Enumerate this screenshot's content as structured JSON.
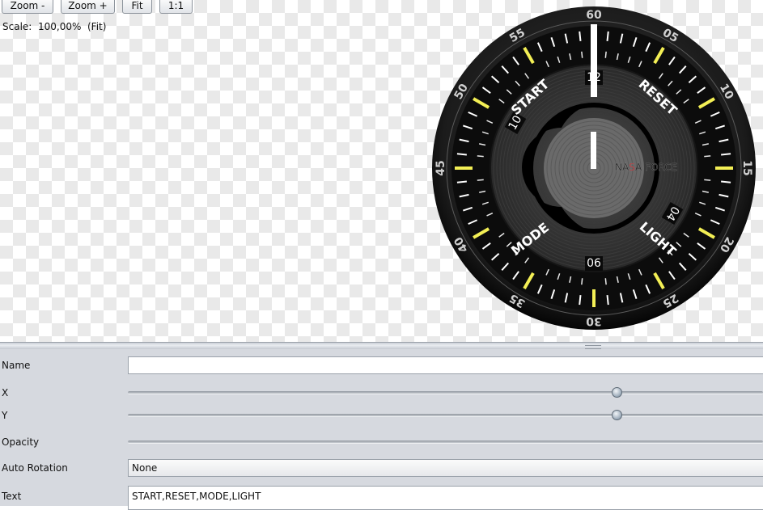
{
  "toolbar": {
    "zoom_out_label": "Zoom -",
    "zoom_in_label": "Zoom +",
    "fit_label": "Fit",
    "actual_size_label": "1:1"
  },
  "status": {
    "scale_label": "Scale:",
    "scale_value": "100,00%",
    "scale_mode": "(Fit)"
  },
  "dial": {
    "minute_numbers": [
      "60",
      "05",
      "10",
      "15",
      "20",
      "25",
      "30",
      "35",
      "40",
      "45",
      "50",
      "55"
    ],
    "inner_numbers": [
      "12",
      "04",
      "06",
      "10"
    ],
    "buttons": [
      "START",
      "RESET",
      "MODE",
      "LIGHT"
    ],
    "brand": "NASA FORCE",
    "colors": {
      "bezel": "#1c1c1c",
      "face": "#111111",
      "marker": "#f3ef55",
      "hand": "#ffffff",
      "brand_accent": "#d8262b"
    }
  },
  "properties": {
    "name": {
      "label": "Name",
      "value": ""
    },
    "x": {
      "label": "X",
      "value_percent": 77
    },
    "y": {
      "label": "Y",
      "value_percent": 77
    },
    "opacity": {
      "label": "Opacity"
    },
    "auto_rotation": {
      "label": "Auto Rotation",
      "value": "None"
    },
    "text": {
      "label": "Text",
      "value": "START,RESET,MODE,LIGHT"
    }
  }
}
